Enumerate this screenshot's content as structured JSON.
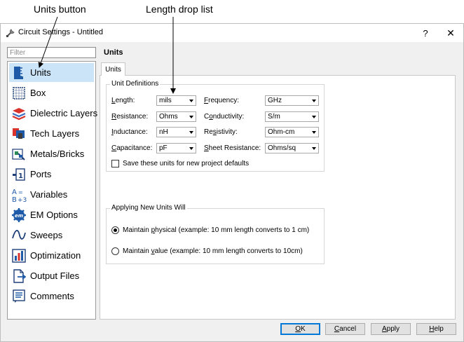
{
  "callouts": {
    "units_button": "Units button",
    "length_list": "Length drop list"
  },
  "window": {
    "title": "Circuit Settings - Untitled",
    "help": "?",
    "close": "✕"
  },
  "filter": {
    "placeholder": "Filter"
  },
  "nav": {
    "items": [
      {
        "label": "Units",
        "icon": "ruler-icon",
        "selected": true
      },
      {
        "label": "Box",
        "icon": "box-grid-icon"
      },
      {
        "label": "Dielectric Layers",
        "icon": "dielectric-layers-icon"
      },
      {
        "label": "Tech Layers",
        "icon": "tech-layers-icon"
      },
      {
        "label": "Metals/Bricks",
        "icon": "metals-bricks-icon"
      },
      {
        "label": "Ports",
        "icon": "ports-icon"
      },
      {
        "label": "Variables",
        "icon": "variables-icon"
      },
      {
        "label": "EM Options",
        "icon": "em-options-icon"
      },
      {
        "label": "Sweeps",
        "icon": "sweeps-icon"
      },
      {
        "label": "Optimization",
        "icon": "optimization-icon"
      },
      {
        "label": "Output Files",
        "icon": "output-files-icon"
      },
      {
        "label": "Comments",
        "icon": "comments-icon"
      }
    ]
  },
  "page": {
    "title": "Units",
    "tab": "Units"
  },
  "unit_definitions": {
    "title": "Unit Definitions",
    "length": {
      "label_u": "L",
      "label_rest": "ength:",
      "value": "mils"
    },
    "resistance": {
      "label_u": "R",
      "label_rest": "esistance:",
      "value": "Ohms"
    },
    "inductance": {
      "label_u": "I",
      "label_rest": "nductance:",
      "value": "nH"
    },
    "capacitance": {
      "label_u": "C",
      "label_rest": "apacitance:",
      "value": "pF"
    },
    "frequency": {
      "label_u": "F",
      "label_rest": "requency:",
      "value": "GHz"
    },
    "conductivity": {
      "label_pre": "C",
      "label_u": "o",
      "label_rest": "nductivity:",
      "value": "S/m"
    },
    "resistivity": {
      "label_pre": "Re",
      "label_u": "s",
      "label_rest": "istivity:",
      "value": "Ohm-cm"
    },
    "sheet_resistance": {
      "label_u": "S",
      "label_rest": "heet Resistance:",
      "value": "Ohms/sq"
    },
    "save_defaults": "Save these units for new project defaults"
  },
  "applying": {
    "title": "Applying New Units Will",
    "physical": {
      "pre": "Maintain ",
      "u": "p",
      "rest": "hysical (example: 10 mm length converts to 1 cm)",
      "checked": true
    },
    "value": {
      "pre": "Maintain ",
      "u": "v",
      "rest": "alue (example: 10 mm length converts to 10cm)",
      "checked": false
    }
  },
  "buttons": {
    "ok": {
      "u": "O",
      "rest": "K"
    },
    "cancel": {
      "u": "C",
      "rest": "ancel"
    },
    "apply": {
      "u": "A",
      "rest": "pply"
    },
    "help": {
      "u": "H",
      "rest": "elp"
    }
  },
  "colors": {
    "selection": "#cce4f7",
    "accent": "#0078d7",
    "icon_blue": "#1e5aa8",
    "icon_red": "#d9342b"
  }
}
